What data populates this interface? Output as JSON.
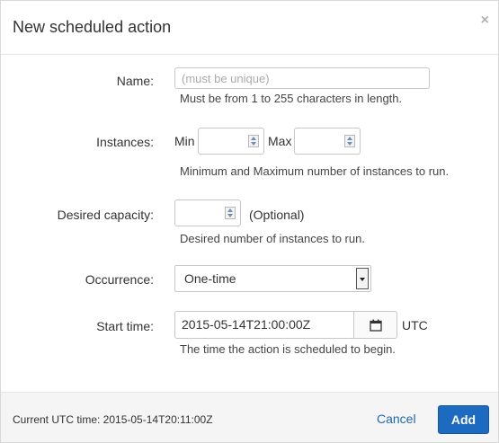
{
  "dialog": {
    "title": "New scheduled action",
    "close_glyph": "×"
  },
  "form": {
    "name": {
      "label": "Name:",
      "placeholder": "(must be unique)",
      "value": "",
      "hint": "Must be from 1 to 255 characters in length."
    },
    "instances": {
      "label": "Instances:",
      "min_label": "Min",
      "max_label": "Max",
      "min_value": "",
      "max_value": "",
      "hint": "Minimum and Maximum number of instances to run."
    },
    "desired_capacity": {
      "label": "Desired capacity:",
      "value": "",
      "optional": "(Optional)",
      "hint": "Desired number of instances to run."
    },
    "occurrence": {
      "label": "Occurrence:",
      "selected": "One-time"
    },
    "start_time": {
      "label": "Start time:",
      "value": "2015-05-14T21:00:00Z",
      "tz": "UTC",
      "hint": "The time the action is scheduled to begin.",
      "calendar_icon": "calendar-icon"
    }
  },
  "footer": {
    "current_utc": "Current UTC time: 2015-05-14T20:11:00Z",
    "cancel_label": "Cancel",
    "add_label": "Add"
  },
  "colors": {
    "primary": "#1d6ac1",
    "link": "#1f67b0",
    "footer_bg": "#f5f5f5"
  }
}
